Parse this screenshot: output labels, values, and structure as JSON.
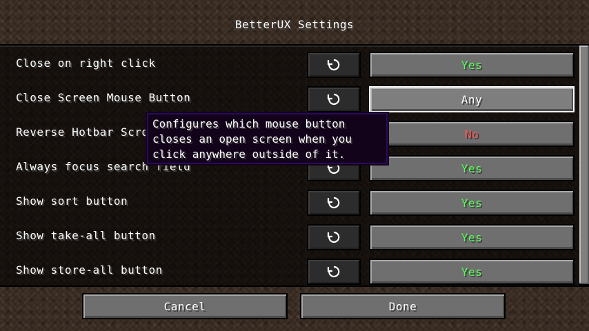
{
  "screen": {
    "title": "BetterUX Settings"
  },
  "options": [
    {
      "label": "Close on right click",
      "value": "Yes",
      "value_color": "#55ff55"
    },
    {
      "label": "Close Screen Mouse Button",
      "value": "Any",
      "value_color": "#ffffff"
    },
    {
      "label": "Reverse Hotbar Scroll",
      "value": "No",
      "value_color": "#ff5555"
    },
    {
      "label": "Always focus search field",
      "value": "Yes",
      "value_color": "#55ff55"
    },
    {
      "label": "Show sort button",
      "value": "Yes",
      "value_color": "#55ff55"
    },
    {
      "label": "Show take-all button",
      "value": "Yes",
      "value_color": "#55ff55"
    },
    {
      "label": "Show store-all button",
      "value": "Yes",
      "value_color": "#55ff55"
    }
  ],
  "reset_icon": "reset-arrow-icon",
  "tooltip": {
    "lines": [
      "Configures which mouse button",
      "closes an open screen when you",
      "click anywhere outside of it."
    ]
  },
  "footer": {
    "cancel_label": "Cancel",
    "done_label": "Done"
  }
}
